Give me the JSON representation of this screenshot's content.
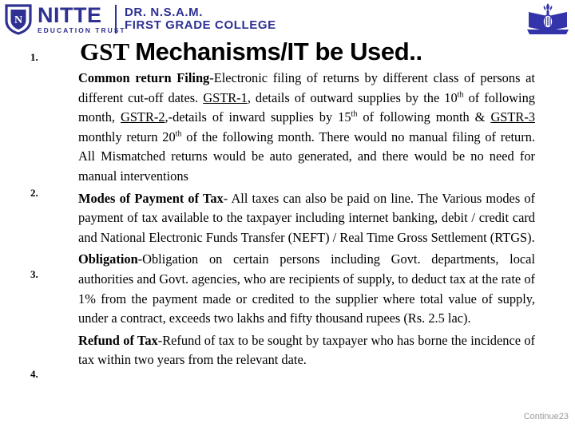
{
  "header": {
    "brand": {
      "name": "NITTE",
      "tagline": "EDUCATION TRUST",
      "shield_icon": "nitte-shield-icon"
    },
    "college_line_1": "DR. N.S.A.M.",
    "college_line_2": "FIRST GRADE COLLEGE",
    "emblem_icon": "college-emblem-icon",
    "brand_color": "#2e3192"
  },
  "title": {
    "serif_part": "GST ",
    "sans_part": "Mechanisms/IT be Used.."
  },
  "markers": [
    {
      "label": "1."
    },
    {
      "label": "2."
    },
    {
      "label": "3."
    },
    {
      "label": "4."
    }
  ],
  "paragraphs": [
    {
      "heading": "Common return Filing",
      "text_1": "-Electronic filing of returns by different class of persons at different cut-off dates. ",
      "link_1": "GSTR-1",
      "text_2": ", details of outward supplies by the 10",
      "sup_1": "th",
      "text_3": " of following month, ",
      "link_2": "GSTR-2",
      "text_4": ",-details of inward supplies by 15",
      "sup_2": "th",
      "text_5": " of following month & ",
      "link_3": "GSTR-3",
      "text_6": " monthly return 20",
      "sup_3": "th",
      "text_7": " of the following month. There would no manual filing of return. All Mismatched returns would be auto generated, and there would be no need for manual interventions"
    },
    {
      "heading": "Modes of Payment of Tax",
      "text_1": "- All taxes can also be paid on line. The Various modes of payment of tax available to the taxpayer including internet banking, debit / credit card and National Electronic Funds Transfer (NEFT) / Real Time Gross Settlement (RTGS)."
    },
    {
      "heading": "Obligation",
      "text_1": "-Obligation on certain persons including Govt. departments, local authorities and Govt. agencies, who are recipients of supply, to deduct tax at the rate of 1% from the payment made or credited to the supplier where total value of supply, under a contract, exceeds two lakhs and fifty thousand rupees (Rs. 2.5 lac)."
    },
    {
      "heading": "Refund of Tax",
      "text_1": "-Refund of tax to be sought by taxpayer who has borne the incidence of tax within two years from the relevant date."
    }
  ],
  "footer": {
    "continue_label": "Continue",
    "page_number": "23"
  }
}
